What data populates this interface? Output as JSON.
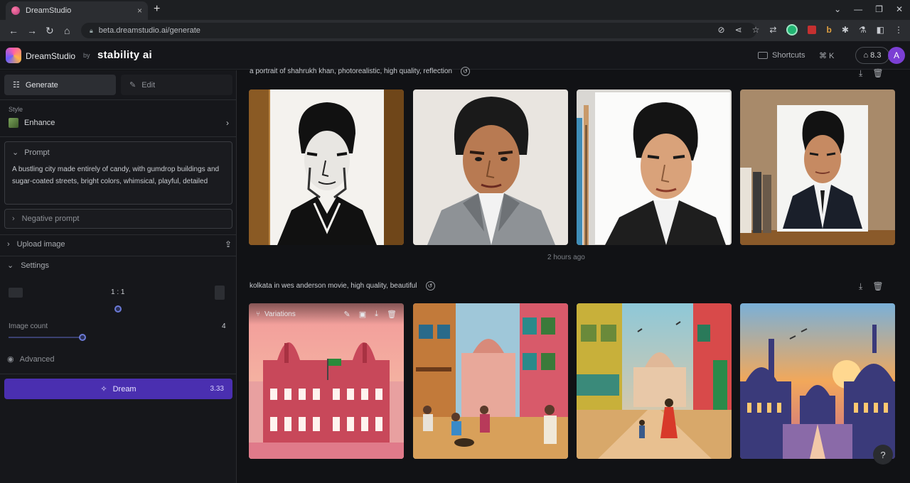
{
  "browser": {
    "tab_title": "DreamStudio",
    "tab_close": "×",
    "new_tab": "+",
    "url": "beta.dreamstudio.ai/generate",
    "window_controls": [
      "⌄",
      "—",
      "❐",
      "✕"
    ]
  },
  "header": {
    "brand": "DreamStudio",
    "by": "by",
    "company": "stability ai",
    "shortcuts_label": "Shortcuts",
    "shortcut_keys": "⌘ K",
    "credits": "8.3",
    "avatar_initial": "A"
  },
  "sidebar": {
    "tabs": {
      "generate": "Generate",
      "edit": "Edit"
    },
    "style_label": "Style",
    "style_value": "Enhance",
    "prompt_label": "Prompt",
    "prompt_text": "A bustling city made entirely of candy, with gumdrop buildings and sugar-coated streets, bright colors, whimsical, playful, detailed",
    "negative_prompt_label": "Negative prompt",
    "upload_label": "Upload image",
    "settings_label": "Settings",
    "aspect_ratio": "1 : 1",
    "image_count_label": "Image count",
    "image_count_value": "4",
    "image_count_fraction": 1.0,
    "advanced_label": "Advanced",
    "dream_label": "Dream",
    "dream_cost": "3.33"
  },
  "main": {
    "groups": [
      {
        "prompt": "a portrait of shahrukh khan, photorealistic, high quality, reflection",
        "timestamp": "2 hours ago"
      },
      {
        "prompt": "kolkata in wes anderson movie, high quality, beautiful",
        "hover_overlay_label": "Variations"
      }
    ],
    "help": "?"
  },
  "colors": {
    "accent": "#4a2fb0",
    "avatar": "#7b3fd4",
    "background": "#111215",
    "sidebar": "#16171b"
  }
}
